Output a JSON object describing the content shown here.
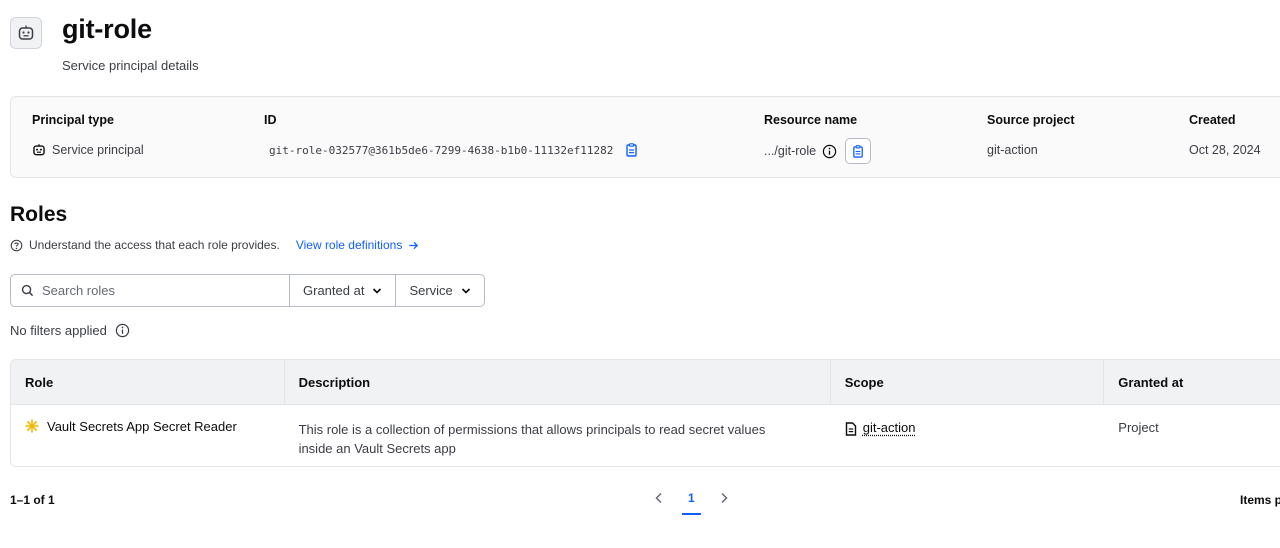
{
  "header": {
    "title": "git-role",
    "subtitle": "Service principal details",
    "icon": "robot-icon"
  },
  "details": {
    "principal_type_label": "Principal type",
    "principal_type_value": "Service principal",
    "id_label": "ID",
    "id_value": "git-role-032577@361b5de6-7299-4638-b1b0-11132ef11282",
    "resource_name_label": "Resource name",
    "resource_name_value": ".../git-role",
    "source_project_label": "Source project",
    "source_project_value": "git-action",
    "created_label": "Created",
    "created_value": "Oct 28, 2024"
  },
  "roles": {
    "title": "Roles",
    "help_text": "Understand the access that each role provides.",
    "link_text": "View role definitions",
    "search_placeholder": "Search roles",
    "filter_granted": "Granted at",
    "filter_service": "Service",
    "no_filters": "No filters applied"
  },
  "table": {
    "columns": [
      "Role",
      "Description",
      "Scope",
      "Granted at"
    ],
    "rows": [
      {
        "role": "Vault Secrets App Secret Reader",
        "description": "This role is a collection of permissions that allows principals to read secret values inside an Vault Secrets app",
        "scope": "git-action",
        "granted_at": "Project"
      }
    ]
  },
  "pagination": {
    "count": "1–1 of 1",
    "current_page": "1",
    "items_per_page": "Items p"
  },
  "colors": {
    "accent": "#1060ff",
    "role_icon": "#f2b600"
  }
}
